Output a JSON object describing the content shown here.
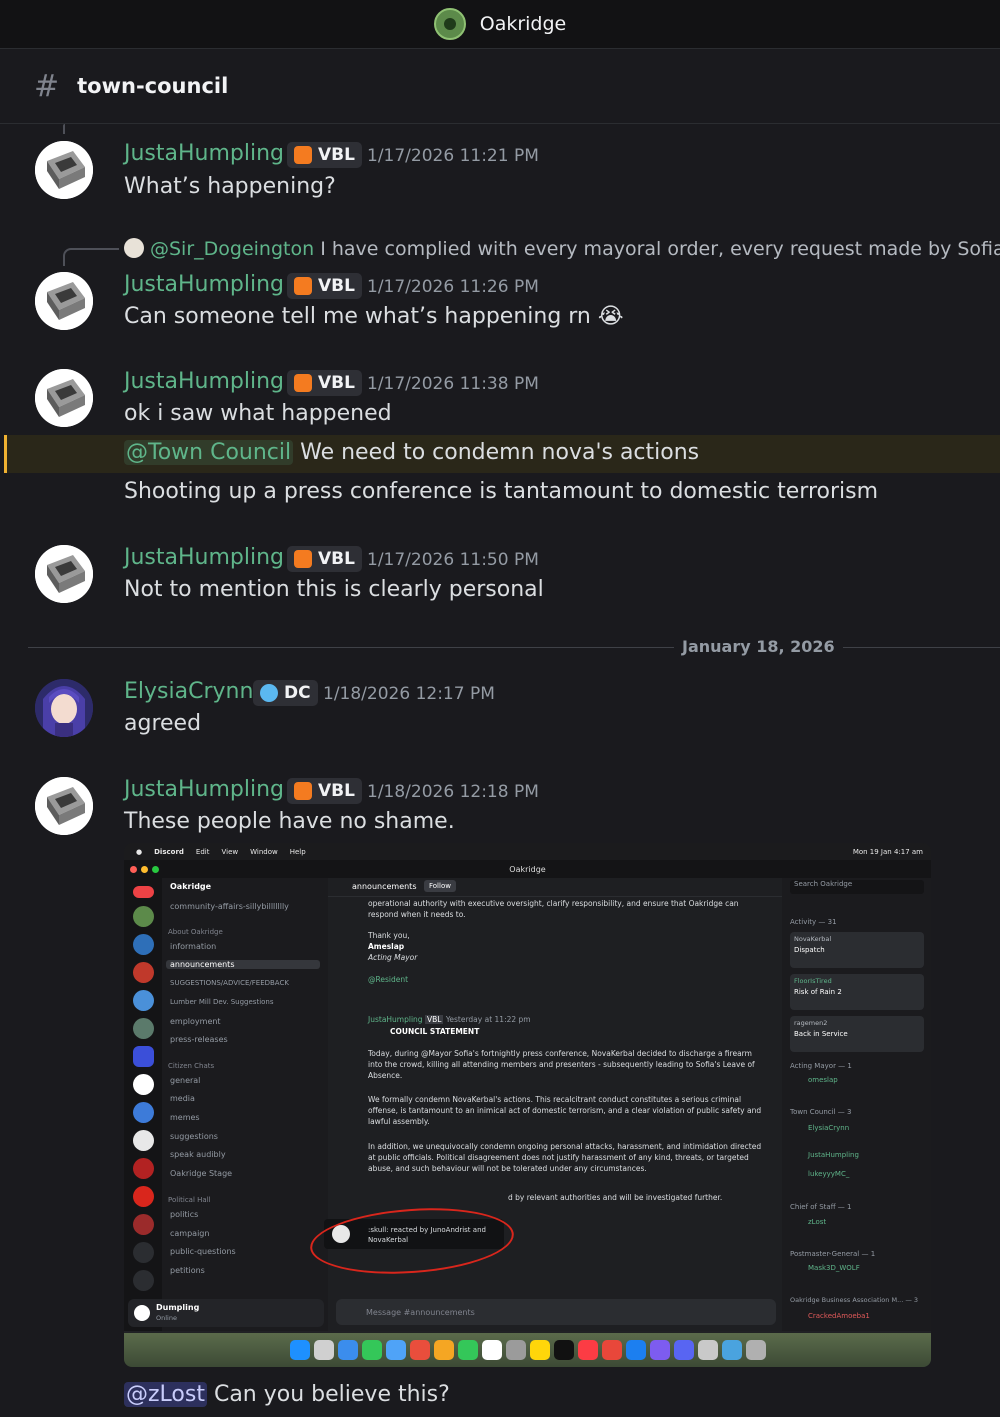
{
  "window": {
    "server_name": "Oakridge"
  },
  "channel": {
    "hash": "#",
    "name": "town-council"
  },
  "colors": {
    "role_green": "#5fb58a",
    "mention_bg": "#3b3f7a",
    "highlight_bar": "#f0b232"
  },
  "messages": [
    {
      "id": "m1",
      "username": "JustaHumpling",
      "tag": "VBL",
      "timestamp": "1/17/2026 11:21 PM",
      "text": "What’s happening?"
    },
    {
      "id": "m2",
      "reply_to_user": "@Sir_Dogeington",
      "reply_text": "I have complied with every mayoral order, every request made by Sofia, If the",
      "username": "JustaHumpling",
      "tag": "VBL",
      "timestamp": "1/17/2026 11:26 PM",
      "text": "Can someone tell me what’s happening rn",
      "emoji": "😭"
    },
    {
      "id": "m3",
      "username": "JustaHumpling",
      "tag": "VBL",
      "timestamp": "1/17/2026 11:38 PM",
      "text": "ok i saw what happened",
      "mention": "@Town Council",
      "mention_text": "We need to condemn nova's actions",
      "text3": "Shooting up a press conference is tantamount to domestic terrorism"
    },
    {
      "id": "m4",
      "username": "JustaHumpling",
      "tag": "VBL",
      "timestamp": "1/17/2026 11:50 PM",
      "text": "Not to mention this is clearly personal"
    },
    {
      "id": "m5",
      "username": "ElysiaCrynn",
      "tag": "DC",
      "timestamp": "1/18/2026 12:17 PM",
      "text": "agreed"
    },
    {
      "id": "m6",
      "username": "JustaHumpling",
      "tag": "VBL",
      "timestamp": "1/18/2026 12:18 PM",
      "text": "These people have no shame.",
      "mention": "@zLost",
      "mention_text": "Can you believe this?"
    }
  ],
  "date_divider": "January 18, 2026",
  "screenshot": {
    "menubar": [
      "Discord",
      "Edit",
      "View",
      "Window",
      "Help"
    ],
    "clock": "Mon 19 Jan  4:17 am",
    "server_name": "Oakridge",
    "channel_title": "announcements",
    "follow_label": "Follow",
    "search_placeholder": "Search Oakridge",
    "channels": [
      "community-affairs-sillybillllllly",
      "About Oakridge",
      "information",
      "announcements",
      "SUGGESTIONS/ADVICE/FEEDBACK",
      "Lumber Mill Dev. Suggestions",
      "employment",
      "press-releases",
      "Citizen Chats",
      "general",
      "media",
      "memes",
      "suggestions",
      "speak audibly",
      "Oakridge Stage",
      "Political Hall",
      "politics",
      "campaign",
      "public-questions",
      "petitions"
    ],
    "post_intro": "operational authority with executive oversight, clarify responsibility, and ensure that Oakridge can respond when it needs to.",
    "sign_off": "Thank you,",
    "signer": "Ameslap",
    "signer_title": "Acting Mayor",
    "resident_tag": "@Resident",
    "statement_author": "JustaHumpling",
    "statement_tag": "VBL",
    "statement_time": "Yesterday at 11:22 pm",
    "statement_title": "COUNCIL STATEMENT",
    "para1": "Today, during @Mayor Sofia's fortnightly press conference, NovaKerbal decided to discharge a firearm into the crowd, killing all attending members and presenters - subsequently leading to Sofia's Leave of Absence.",
    "para2": "We formally condemn NovaKerbal's actions. This recalcitrant conduct constitutes a serious criminal offense, is tantamount to an inimical act of domestic terrorism, and a clear violation of public safety and lawful assembly.",
    "para3": "In addition, we unequivocally condemn ongoing personal attacks, harassment, and intimidation directed at public officials. Political disagreement does not justify harassment of any kind, threats, or targeted abuse, and such behaviour will not be tolerated under any circumstances.",
    "para4": "d by relevant authorities and will be investigated further.",
    "tooltip": ":skull: reacted by JunoAndrist and NovaKerbal",
    "input_placeholder": "Message #announcements",
    "user_name": "Dumpling",
    "user_status": "Online",
    "activity_header": "Activity — 31",
    "members": [
      "NovaKerbal",
      "Dispatch",
      "FloorIsTired",
      "Risk of Rain 2",
      "ragemen2",
      "Back in Service",
      "Acting Mayor — 1",
      "omeslap",
      "Town Council — 3",
      "ElysiaCrynn",
      "JustaHumpling",
      "lukeyyyMC_",
      "Chief of Staff — 1",
      "zLost",
      "Postmaster-General — 1",
      "Mask3D_WOLF",
      "Oakridge Business Association M... — 3",
      "CrackedAmoeba1"
    ]
  }
}
